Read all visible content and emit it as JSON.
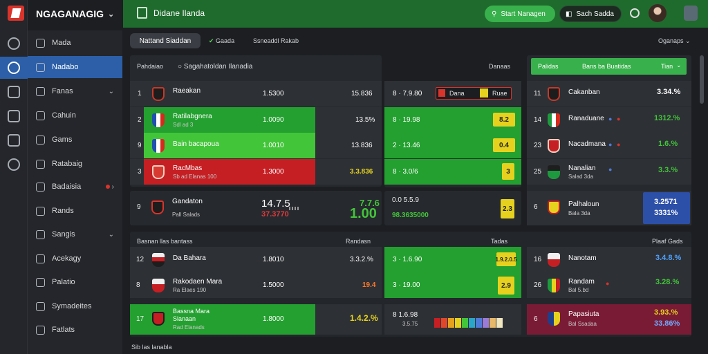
{
  "brand": {
    "name": "NGAGANAGIG"
  },
  "topbar": {
    "title": "Didane Ilanda",
    "start_label": "Start Nanagen",
    "search_label": "Sach Sadda"
  },
  "sidebar": {
    "items": [
      {
        "label": "Mada"
      },
      {
        "label": "Nadabo"
      },
      {
        "label": "Fanas"
      },
      {
        "label": "Cahuin"
      },
      {
        "label": "Gams"
      },
      {
        "label": "Ratabaig"
      },
      {
        "label": "Badaisia"
      },
      {
        "label": "Rands"
      },
      {
        "label": "Sangis"
      },
      {
        "label": "Acekagy"
      },
      {
        "label": "Palatio"
      },
      {
        "label": "Symadeites"
      },
      {
        "label": "Fatlats"
      }
    ]
  },
  "filters": {
    "active": "Nattand Siaddan",
    "f1": "Gaada",
    "f2": "Ssneaddl Rakab",
    "options": "Oganaps"
  },
  "standings": {
    "header_left": "Pahdaiao",
    "header_search": "Sagahatoldan Ilanadia",
    "header_right": "Danaas",
    "rows": [
      {
        "rank": "1",
        "team": "Raeakan",
        "sub": "",
        "v1": "1.5300",
        "v2": "15.836"
      },
      {
        "rank": "2",
        "team": "Ratilabgnera",
        "sub": "Sdl ad 3",
        "v1": "1.0090",
        "v2": "13.5%"
      },
      {
        "rank": "9",
        "team": "Bain bacapoua",
        "sub": "",
        "v1": "1.0010",
        "v2": "13.836"
      },
      {
        "rank": "3",
        "team": "RacMbas",
        "sub": "Sb ad Elanas 100",
        "v1": "1.3000",
        "v2": "3.3.836"
      },
      {
        "rank": "9",
        "team": "Gandaton",
        "sub": "Pall Salads",
        "v1": "14.7.5",
        "v2": "37.3770",
        "v3": "7.7.6",
        "v4": "1.00"
      }
    ]
  },
  "odds": {
    "rows": [
      {
        "v": "8 · 7.9.80",
        "chip1": "Dana",
        "chip2": "Ruae"
      },
      {
        "v": "8 · 19.98",
        "badge": "8.2"
      },
      {
        "v": "2 · 13.46",
        "badge": "0.4"
      },
      {
        "v": "8 · 3.0/6",
        "badge": "3"
      },
      {
        "v": "0.0 5.5.9",
        "v2": "98.3635000",
        "badge": "2.3"
      }
    ]
  },
  "right": {
    "tab1": "Palidas",
    "tab2": "Bans ba Buatidas",
    "tab3": "Tian",
    "rows": [
      {
        "rank": "11",
        "team": "Cakanban",
        "sub": "",
        "pct": "3.34.%"
      },
      {
        "rank": "14",
        "team": "Ranaduane",
        "sub": "",
        "pct": "1312.%"
      },
      {
        "rank": "23",
        "team": "Nacadmana",
        "sub": "",
        "pct": "1.6.%"
      },
      {
        "rank": "25",
        "team": "Nanalian",
        "sub": "Salad 3da",
        "pct": "3.3.%"
      },
      {
        "rank": "6",
        "team": "Palhaloun",
        "sub": "Bala 3da",
        "pct": "3.2571",
        "pct2": "3331%"
      }
    ]
  },
  "lower": {
    "header_left": "Basnan llas bantass",
    "header_mid": "Randasn",
    "header_odds": "Tadas",
    "header_right": "Plaaf Gads",
    "rows": [
      {
        "rank": "12",
        "team": "Da Bahara",
        "sub": "",
        "v1": "1.8010",
        "v2": "3.3.2.%",
        "odds": "3 · 1.6.90",
        "badge": "1.9.2.0.5",
        "rrank": "16",
        "rteam": "Nanotam",
        "rpct": "3.4.8.%"
      },
      {
        "rank": "8",
        "team": "Rakodaen Mara",
        "sub": "Ra Elaes 190",
        "v1": "1.5000",
        "v2": "19.4",
        "odds": "3 · 19.00",
        "badge": "2.9",
        "rrank": "26",
        "rteam": "Randam",
        "rsub": "Bal 5.bd",
        "rpct": "3.28.%"
      },
      {
        "rank": "17",
        "team": "Bassna Mara Slanaan",
        "sub": "Rad Elanads",
        "v1": "1.8000",
        "v2": "1.4.2.%",
        "odds": "8 1.6.98",
        "odds2": "3.5.75",
        "rrank": "6",
        "rteam": "Papasiuta",
        "rsub": "Bal Ssadaa",
        "rpct": "3.93.%",
        "rpct2": "33.86%"
      }
    ]
  },
  "footer": {
    "text": "Sib las lanabla"
  },
  "colors": {
    "green_row": "#23a02f",
    "bright_green": "#43c53a",
    "red_row": "#c51f24",
    "accent_blue": "#2c5fa8",
    "yellow_badge": "#e6d21e"
  }
}
